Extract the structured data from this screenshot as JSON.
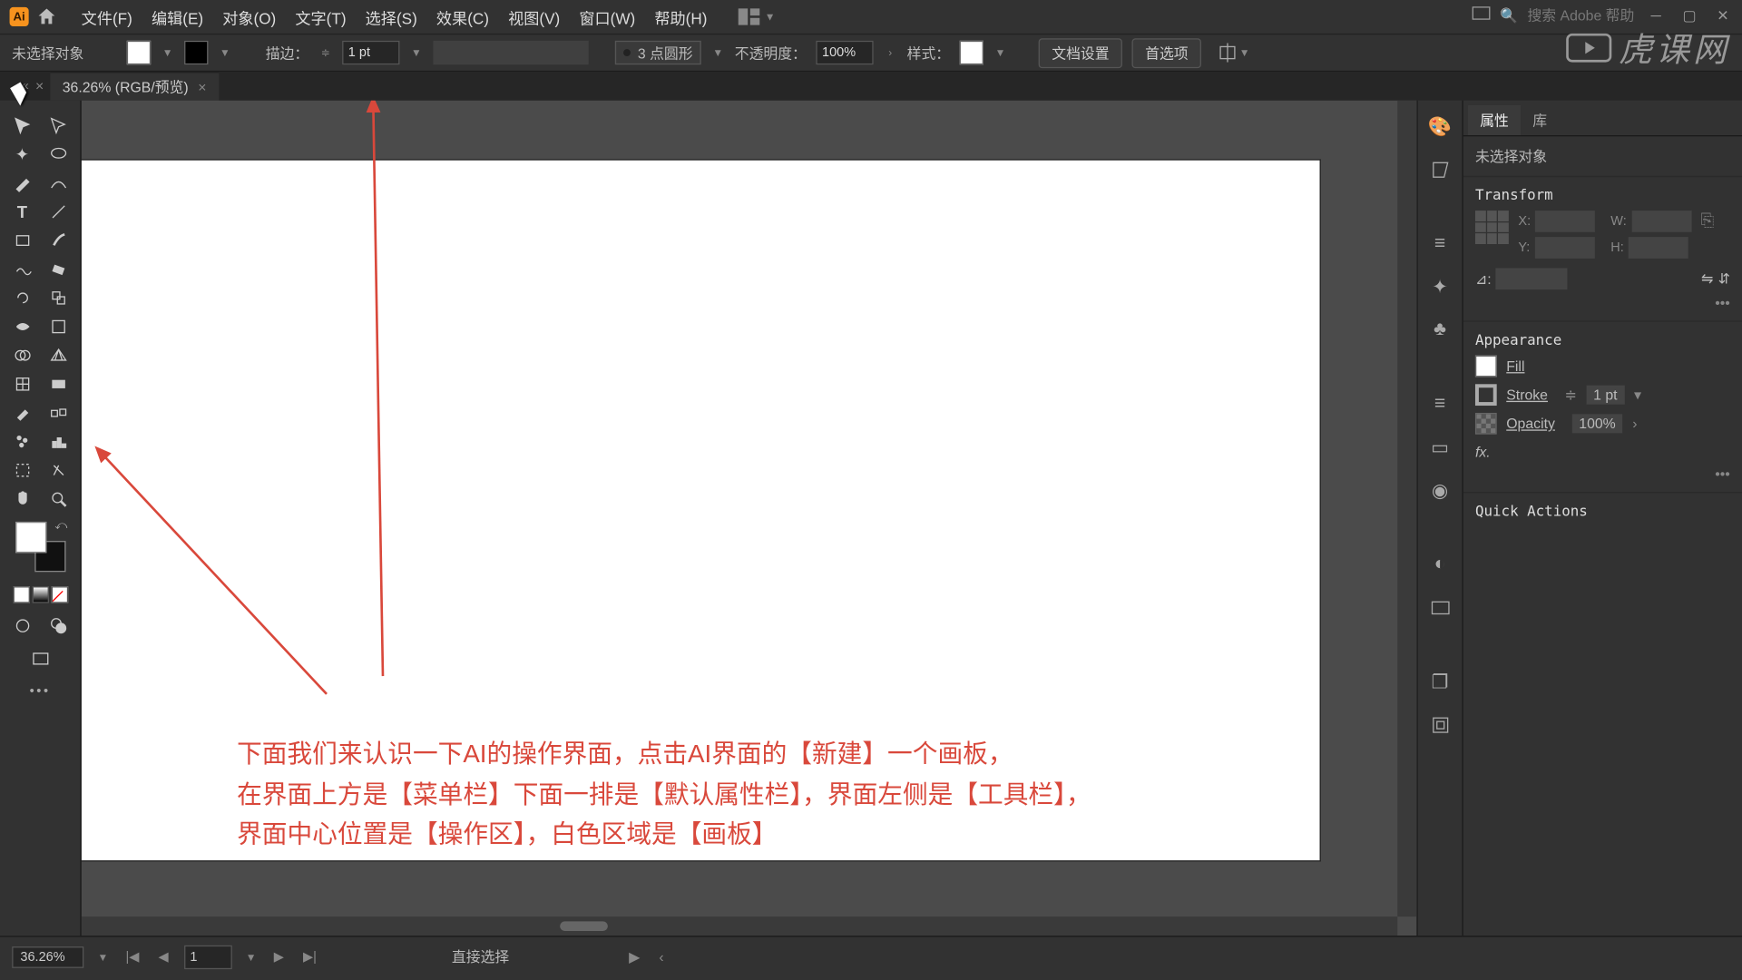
{
  "menubar": {
    "items": [
      "文件(F)",
      "编辑(E)",
      "对象(O)",
      "文字(T)",
      "选择(S)",
      "效果(C)",
      "视图(V)",
      "窗口(W)",
      "帮助(H)"
    ]
  },
  "search_placeholder": "搜索 Adobe 帮助",
  "options": {
    "no_selection": "未选择对象",
    "stroke_label": "描边：",
    "stroke_value": "1 pt",
    "brush_value": "3 点圆形",
    "opacity_label": "不透明度：",
    "opacity_value": "100%",
    "style_label": "样式：",
    "doc_setup": "文档设置",
    "preferences": "首选项"
  },
  "document_tab": "36.26% (RGB/预览)",
  "panels": {
    "properties_tab": "属性",
    "library_tab": "库",
    "no_selection": "未选择对象",
    "transform": "Transform",
    "x_label": "X:",
    "y_label": "Y:",
    "w_label": "W:",
    "h_label": "H:",
    "angle_label": "⊿:",
    "appearance": "Appearance",
    "fill": "Fill",
    "stroke": "Stroke",
    "stroke_val": "1 pt",
    "opacity": "Opacity",
    "opacity_val": "100%",
    "fx": "fx.",
    "quick_actions": "Quick Actions"
  },
  "status": {
    "zoom": "36.26%",
    "artboard_num": "1",
    "tool_hint": "直接选择"
  },
  "annotation": {
    "line1": "下面我们来认识一下AI的操作界面，点击AI界面的【新建】一个画板，",
    "line2": "在界面上方是【菜单栏】下面一排是【默认属性栏】，界面左侧是【工具栏】，",
    "line3": "界面中心位置是【操作区】，白色区域是【画板】"
  },
  "watermark": "虎课网"
}
